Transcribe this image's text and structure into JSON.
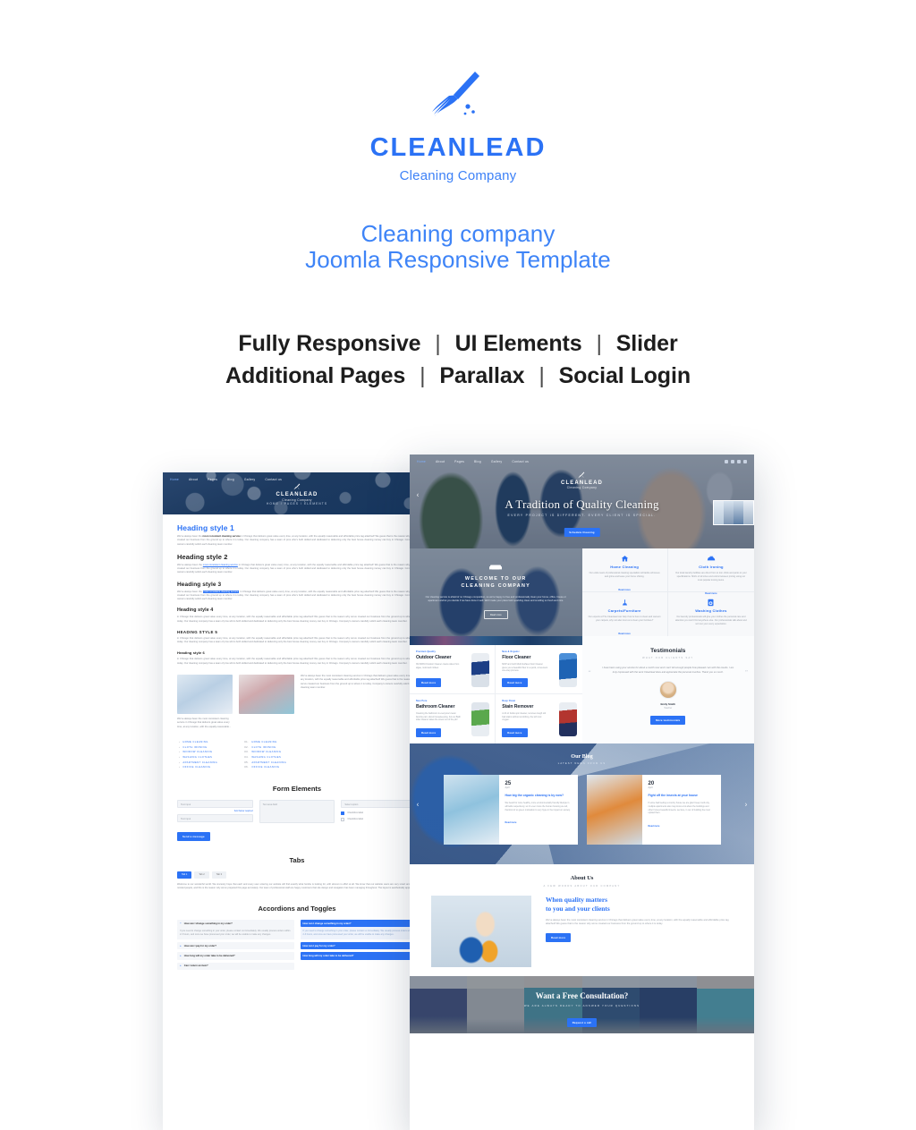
{
  "brand": {
    "name": "CLEANLEAD",
    "tagline": "Cleaning Company",
    "accent": "#2B72F5",
    "logo_icon": "broom-icon"
  },
  "promo": {
    "title_line1": "Cleaning company",
    "title_line2": "Joomla Responsive Template",
    "features_line1": [
      "Fully Responsive",
      "UI Elements",
      "Slider"
    ],
    "features_line2": [
      "Additional Pages",
      "Parallax",
      "Social Login"
    ],
    "separator": "|"
  },
  "nav": {
    "items": [
      "Home",
      "About",
      "Pages",
      "Blog",
      "Gallery",
      "Contact us"
    ],
    "dropdown_marker": "Pages",
    "social_icons": [
      "facebook-icon",
      "twitter-icon",
      "google-plus-icon",
      "rss-icon"
    ]
  },
  "elements_page": {
    "breadcrumb": "HOME  /  PAGES  /  ELEMENTS",
    "headings": [
      {
        "label": "Heading style 1"
      },
      {
        "label": "Heading style 2"
      },
      {
        "label": "Heading style 3"
      },
      {
        "label": "Heading style 4"
      },
      {
        "label": "HEADING STYLE 5"
      },
      {
        "label": "Heading style 6"
      }
    ],
    "paragraph_lead": "We've always been the ",
    "paragraph_strong": "most consistent cleaning service",
    "paragraph_rest": " in Chicago that delivers great value every time, at any location, with the equally reasonable and affordable price tag attached! We guess that is the reason why we've created our business from the ground up to where it is today. Our cleaning company has a team of pros who's both skilled and dedicated to delivering only the best house cleaning money can buy in Chicago. Company's owners carefully solicit each cleaning team member.",
    "image_caption": "We've always been the most consistent cleaning service in Chicago that delivers great value every time, at any location, with the equally reasonable...",
    "image_text": "We've always been the most consistent cleaning service in Chicago that delivers great value every time, at any location, with the equally reasonable and affordable price tag attached! We guess that is the reason why we've created our business from the ground up to where it is today. Company's owners carefully solicit each cleaning team member.",
    "list_items": [
      "HOME CLEANING",
      "CLOTH IRONING",
      "WINDOW CLEANING",
      "WASHING CLOTHES",
      "APARTMENT CLEANING",
      "OFFICE CLEANING"
    ],
    "list_numbers": [
      "01.",
      "02.",
      "03.",
      "04.",
      "05.",
      "06."
    ],
    "form": {
      "title": "Form Elements",
      "text_input_placeholder": "Text input",
      "text_input2_placeholder": "Text input",
      "textarea_placeholder": "Text area field",
      "select_placeholder": "Select option",
      "required_note": "field below required",
      "checkbox1": "Checkbox label",
      "checkbox2": "Checkbox label",
      "submit_label": "Send a message"
    },
    "tabs": {
      "title": "Tabs",
      "items": [
        "Tab 1",
        "Tab 2",
        "Tab 3"
      ],
      "selected": "Tab 1",
      "body": "Welcome to our wonderful world. We sincerely hope that each and every user entering our website will find exactly what he/she is looking for, with almost no effort at all. We know that our website users are very smart and open-minded people, and this is the reason why we've prepared this page accurately. Our team of professional staff are happy customers that site design and navigation has been managing throughout. The layout is aesthetically appealing."
    },
    "accordions": {
      "title": "Accordions and Toggles",
      "items": [
        {
          "q": "How can I change something in my order?",
          "a": "If you need to change something in your order, please contact us immediately. We usually process orders within 2-3 hours, and once we have processed your order, we will be unable to make any changes."
        },
        {
          "q": "How can I pay for my order?"
        },
        {
          "q": "How long will my order take to be delivered?"
        },
        {
          "q": "Can I return an item?"
        }
      ]
    }
  },
  "home_page": {
    "hero": {
      "title": "A Tradition of Quality Cleaning",
      "subtitle": "EVERY PROJECT IS DIFFERENT.  EVERY CLIENT IS SPECIAL.",
      "button": "Schedule Cleaning",
      "prev_arrow": "‹",
      "next_arrow": "›"
    },
    "welcome": {
      "title_line1": "WELCOME TO OUR",
      "title_line2": "CLEANING COMPANY",
      "icon": "sofa-icon",
      "text": "Our cleaning service is afraid of no Chicago competition, so we're happy to free and professionally clean your home, office, house or apartment and let you decide if we have done it well. We'll make your place look sparkling clean and smelling so fresh and nice.",
      "button": "Read more"
    },
    "services": [
      {
        "icon": "home-icon",
        "title": "Home Cleaning",
        "text": "Our entire team of professional cleaning specialists will tackle all issues and grime and leave your home shining.",
        "link": "Read more"
      },
      {
        "icon": "iron-icon",
        "title": "Cloth Ironing",
        "text": "Our local laundry facilities are direct from to iron shirts and pants to your specifications. Shirts of all sizes and colors between pricing using our most popular ironing items.",
        "link": "Read more"
      },
      {
        "icon": "carpet-icon",
        "title": "Carpets/Furniture",
        "text": "Our experts at The Cleanlead can help if we're here to clean and vacuum your carpets, why not also trust us to clean your furniture?",
        "link": "Read more"
      },
      {
        "icon": "washer-icon",
        "title": "Washing Clothes",
        "text": "Our laundry professionals will give your clothes the personal care and attention you won't find anywhere else. Our professionals talk about and sort out your every expectation.",
        "link": "Read more"
      }
    ],
    "products": [
      {
        "tag": "Premium Quality",
        "name": "Outdoor Cleaner",
        "text": "3M 38334 Outdoor Cleaner cleans sides from algae, mold and mildew.",
        "button": "Read more",
        "bottle": "b1"
      },
      {
        "tag": "New & Organic",
        "name": "Floor Cleaner",
        "text": "MOP and GLO Multi-Surface Floor Cleaner gives you a beautiful floor in a quick, convenient one-step process.",
        "button": "Read more",
        "bottle": "b2"
      },
      {
        "tag": "New Pure",
        "name": "Bathroom Cleaner",
        "text": "Cleaning the bathroom is everyone's least favorite part, about housekeeping, but our Bath toilet Cleaner takes the stress out of the job!",
        "button": "Read more",
        "bottle": "b3"
      },
      {
        "tag": "Deep Clean",
        "name": "Stain Remover",
        "text": "A 24 oz bottle spic cleaner, removes tough old bad stains without scrubbing, the left toxic oxygen.",
        "button": "Read more",
        "bottle": "b4"
      }
    ],
    "testimonials": {
      "title": "Testimonials",
      "subtitle": "WHAT OUR CLIENTS SAY",
      "quote": "I have been using your service for about a month now and I can't tell enough people how pleased I am with the results. I am truly impressed with the work Cleanlead does and appreciate the personal touches. Thank you so much.",
      "quote_open": "“",
      "quote_close": "”",
      "author": "Emily Smith",
      "role": "Teacher",
      "button": "More testimonials"
    },
    "blog": {
      "title": "Our Blog",
      "subtitle": "LATEST NEWS FROM US",
      "prev_arrow": "‹",
      "next_arrow": "›",
      "posts": [
        {
          "day": "25",
          "month": "April",
          "title": "How big the organic cleaning is by now?",
          "text": "We heard for more healthy, more environmentally friendly lifestyle in all fields respectively, so it's even more the human housing we tell, that kind of so green motivation to very hype in the impact on society.",
          "link": "Read more"
        },
        {
          "day": "20",
          "month": "April",
          "title": "Fight off the insects at your house",
          "text": "If some bad feeling a country house we are glad I keep roofs city, multiple apartments also may know a lot about the buildings and other homes beautiful insects, we face, in our of building the must upload them.",
          "link": "Read more"
        }
      ]
    },
    "about": {
      "title": "About Us",
      "subtitle": "A FEW WORDS ABOUT OUR COMPANY",
      "heading_line1": "When quality matters",
      "heading_line2": "to you and your clients",
      "text": "We've always been the most consistent cleaning service in Chicago that delivers great value every time, at any location, with the equally reasonable and affordable price tag attached! We guess that is the reason why we've created our business from the ground up to where it is today.",
      "button": "Read more"
    },
    "cta": {
      "title": "Want a Free Consultation?",
      "subtitle": "WE ARE ALWAYS READY TO ANSWER YOUR QUESTIONS",
      "button": "Request a call"
    }
  }
}
